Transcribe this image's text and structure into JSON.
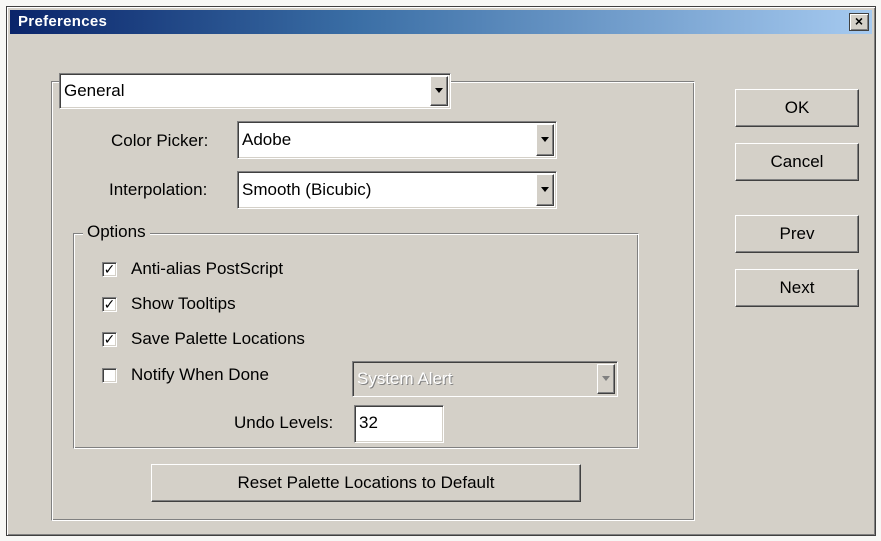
{
  "window": {
    "title": "Preferences",
    "close_glyph": "×"
  },
  "panel_select": {
    "value": "General"
  },
  "color_picker": {
    "label": "Color Picker:",
    "value": "Adobe"
  },
  "interpolation": {
    "label": "Interpolation:",
    "value": "Smooth (Bicubic)"
  },
  "options": {
    "legend": "Options",
    "items": [
      {
        "label": "Anti-alias PostScript",
        "checked": true
      },
      {
        "label": "Show Tooltips",
        "checked": true
      },
      {
        "label": "Save Palette Locations",
        "checked": true
      },
      {
        "label": "Notify When Done",
        "checked": false
      }
    ],
    "notify_sound": {
      "value": "System Alert",
      "enabled": false
    },
    "undo_levels": {
      "label": "Undo Levels:",
      "value": "32"
    }
  },
  "reset_button": {
    "label": "Reset Palette Locations to Default"
  },
  "buttons": {
    "ok": "OK",
    "cancel": "Cancel",
    "prev": "Prev",
    "next": "Next"
  },
  "icons": {
    "check": "✓",
    "dropdown": "chevron-down-icon",
    "close": "close-icon"
  }
}
